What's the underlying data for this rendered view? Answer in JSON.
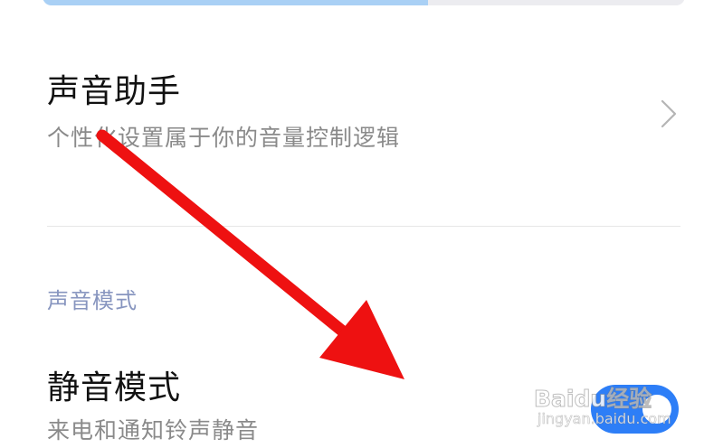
{
  "top_progress": {
    "fill_fraction": 0.6
  },
  "sound_assistant": {
    "title": "声音助手",
    "subtitle": "个性化设置属于你的音量控制逻辑"
  },
  "sound_mode_section": {
    "header": "声音模式"
  },
  "silent_mode": {
    "title": "静音模式",
    "subtitle": "来电和通知铃声静音",
    "enabled": true
  },
  "watermark": {
    "main": "Baidu经验",
    "sub": "jingyan.baidu.com"
  },
  "colors": {
    "accent": "#2d7ef7",
    "section_header": "#8795bf",
    "annotation_arrow": "#ee1111"
  }
}
